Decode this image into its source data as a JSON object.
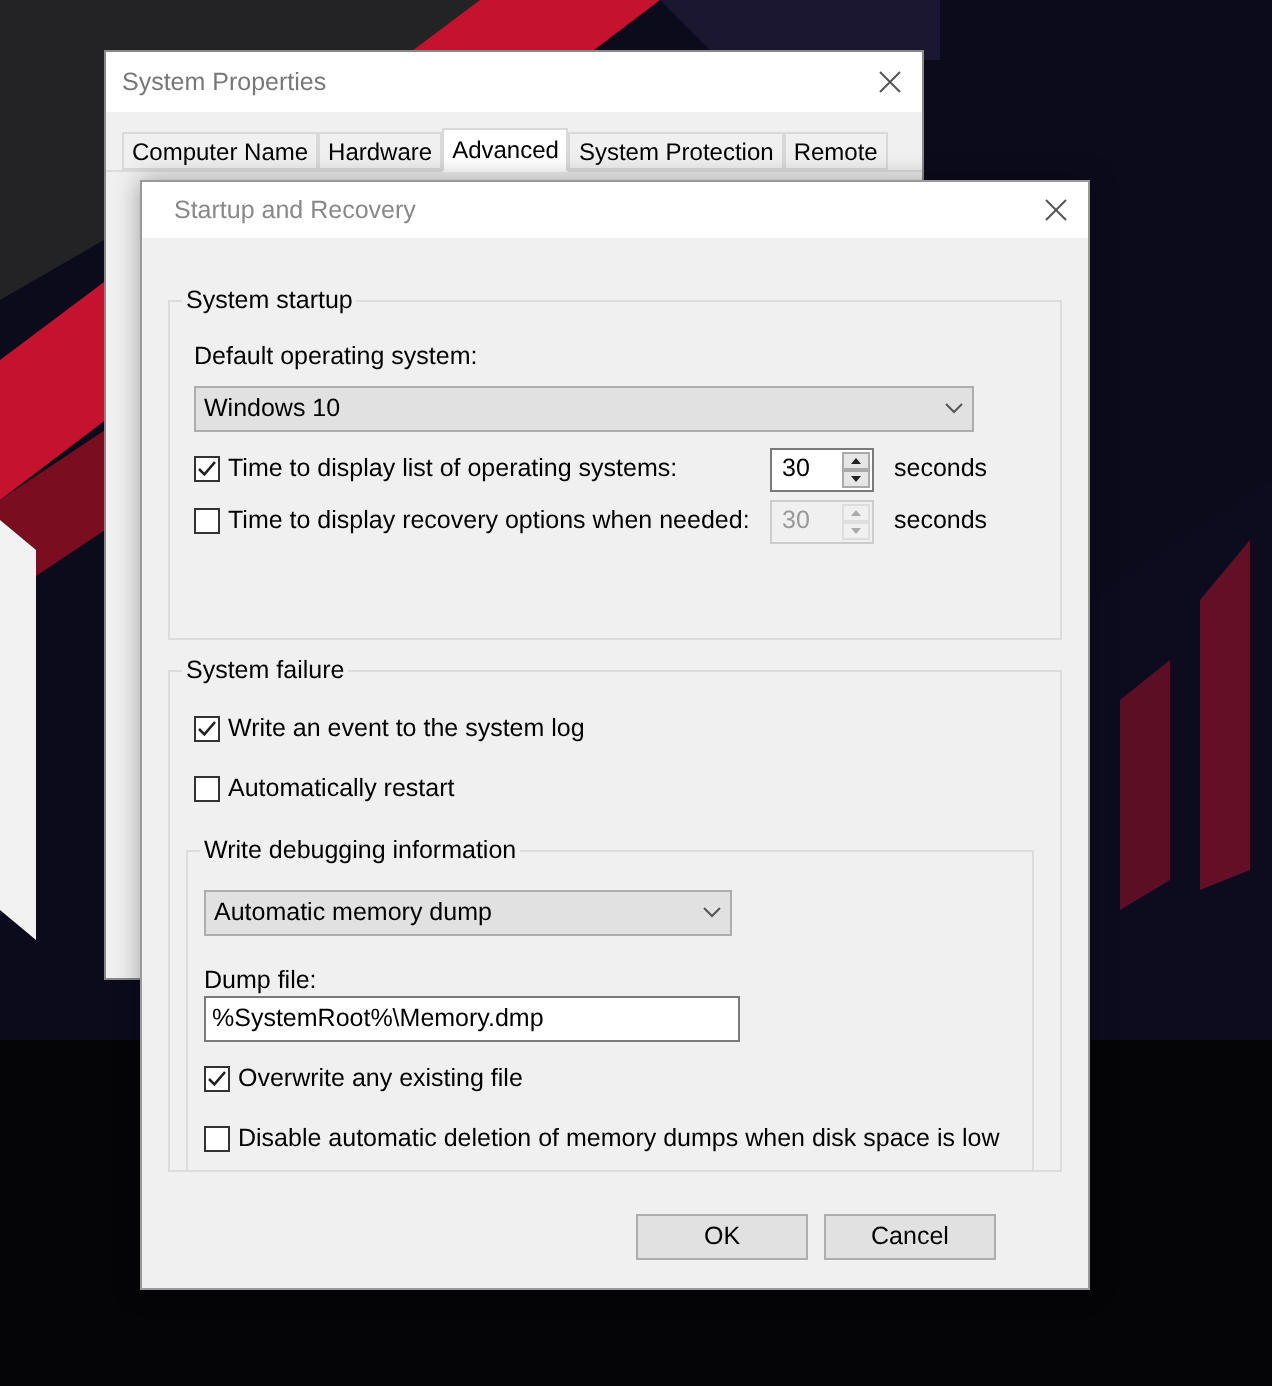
{
  "back_window": {
    "title": "System Properties",
    "tabs": [
      {
        "label": "Computer Name",
        "selected": false
      },
      {
        "label": "Hardware",
        "selected": false
      },
      {
        "label": "Advanced",
        "selected": true
      },
      {
        "label": "System Protection",
        "selected": false
      },
      {
        "label": "Remote",
        "selected": false
      }
    ]
  },
  "dialog": {
    "title": "Startup and Recovery",
    "system_startup": {
      "heading": "System startup",
      "default_os_label": "Default operating system:",
      "default_os": "Windows 10",
      "timers": [
        {
          "label": "Time to display list of operating systems:",
          "checked": true,
          "value": "30",
          "unit": "seconds"
        },
        {
          "label": "Time to display recovery options when needed:",
          "checked": false,
          "value": "30",
          "unit": "seconds"
        }
      ]
    },
    "system_failure": {
      "heading": "System failure",
      "options": [
        {
          "label": "Write an event to the system log",
          "checked": true
        },
        {
          "label": "Automatically restart",
          "checked": false
        }
      ],
      "debugging": {
        "heading": "Write debugging information",
        "dump_type": "Automatic memory dump",
        "dump_file_label": "Dump file:",
        "dump_file": "%SystemRoot%\\Memory.dmp",
        "options": [
          {
            "label": "Overwrite any existing file",
            "checked": true
          },
          {
            "label": "Disable automatic deletion of memory dumps when disk space is low",
            "checked": false
          }
        ]
      }
    },
    "buttons": [
      "OK",
      "Cancel"
    ]
  }
}
